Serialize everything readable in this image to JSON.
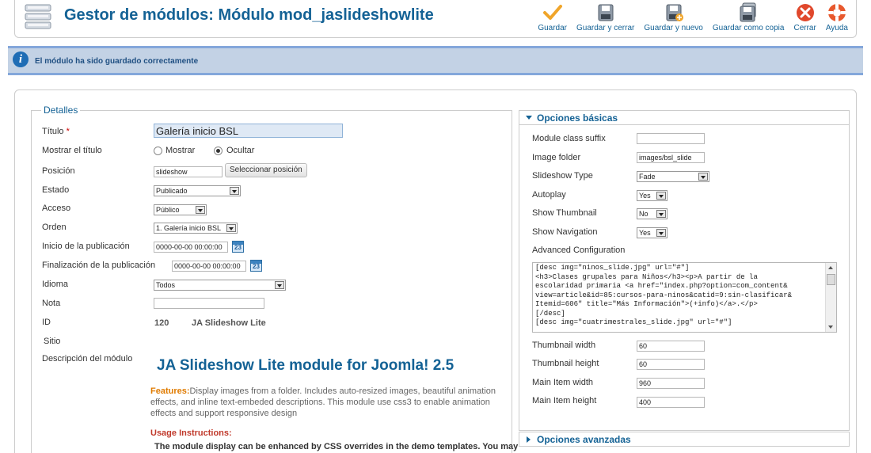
{
  "header": {
    "title": "Gestor de módulos: Módulo mod_jaslideshowlite",
    "toolbar": [
      {
        "label": "Guardar",
        "icon": "check-icon"
      },
      {
        "label": "Guardar y cerrar",
        "icon": "save-close-icon"
      },
      {
        "label": "Guardar y nuevo",
        "icon": "save-new-icon"
      },
      {
        "label": "Guardar como copia",
        "icon": "save-copy-icon"
      },
      {
        "label": "Cerrar",
        "icon": "close-icon"
      },
      {
        "label": "Ayuda",
        "icon": "help-icon"
      }
    ]
  },
  "message": {
    "text": "El módulo ha sido guardado correctamente",
    "icon": "info-icon"
  },
  "details": {
    "legend": "Detalles",
    "title_label": "Título",
    "title_required": "*",
    "title_value": "Galería inicio BSL",
    "show_title_label": "Mostrar el título",
    "show_option": "Mostrar",
    "hide_option": "Ocultar",
    "show_title_selected": "Ocultar",
    "position_label": "Posición",
    "position_value": "slideshow",
    "select_position_button": "Seleccionar posición",
    "state_label": "Estado",
    "state_value": "Publicado",
    "access_label": "Acceso",
    "access_value": "Público",
    "order_label": "Orden",
    "order_value": "1. Galería inicio BSL",
    "publish_up_label": "Inicio de la publicación",
    "publish_up_value": "0000-00-00 00:00:00",
    "publish_down_label": "Finalización de la publicación",
    "publish_down_value": "0000-00-00 00:00:00",
    "calendar_text": "23",
    "language_label": "Idioma",
    "language_value": "Todos",
    "note_label": "Nota",
    "note_value": "",
    "id_label": "ID",
    "id_value": "120",
    "module_name": "JA Slideshow Lite",
    "site_label": "Sitio",
    "description_label": "Descripción del módulo",
    "description_title": "JA Slideshow Lite module for Joomla! 2.5",
    "features_label": "Features:",
    "features_text": "Display images from a folder. Includes auto-resized images, beautiful animation effects, and inline text-embeded descriptions. This module use css3 to enable animation effects and support responsive design",
    "usage_title": "Usage Instructions:",
    "usage_text": "The module display can be enhanced by CSS overrides in the demo templates. You may"
  },
  "basic_options": {
    "title": "Opciones básicas",
    "module_class_suffix_label": "Module class suffix",
    "module_class_suffix_value": "",
    "image_folder_label": "Image folder",
    "image_folder_value": "images/bsl_slide",
    "slideshow_type_label": "Slideshow Type",
    "slideshow_type_value": "Fade",
    "autoplay_label": "Autoplay",
    "autoplay_value": "Yes",
    "show_thumbnail_label": "Show Thumbnail",
    "show_thumbnail_value": "No",
    "show_navigation_label": "Show Navigation",
    "show_navigation_value": "Yes",
    "advanced_config_label": "Advanced Configuration",
    "advanced_config_value": "[desc img=\"ninos_slide.jpg\" url=\"#\"]\n<h3>Clases grupales para Niños</h3><p>A partir de la\nescolaridad primaria <a href=\"index.php?option=com_content&\nview=article&id=85:cursos-para-ninos&catid=9:sin-clasificar&\nItemid=606\" title=\"Más Información\">(+info)</a>.</p>\n[/desc]\n[desc img=\"cuatrimestrales_slide.jpg\" url=\"#\"]",
    "thumbnail_width_label": "Thumbnail width",
    "thumbnail_width_value": "60",
    "thumbnail_height_label": "Thumbnail height",
    "thumbnail_height_value": "60",
    "main_item_width_label": "Main Item width",
    "main_item_width_value": "960",
    "main_item_height_label": "Main Item height",
    "main_item_height_value": "400"
  },
  "advanced_options": {
    "title": "Opciones avanzadas"
  }
}
